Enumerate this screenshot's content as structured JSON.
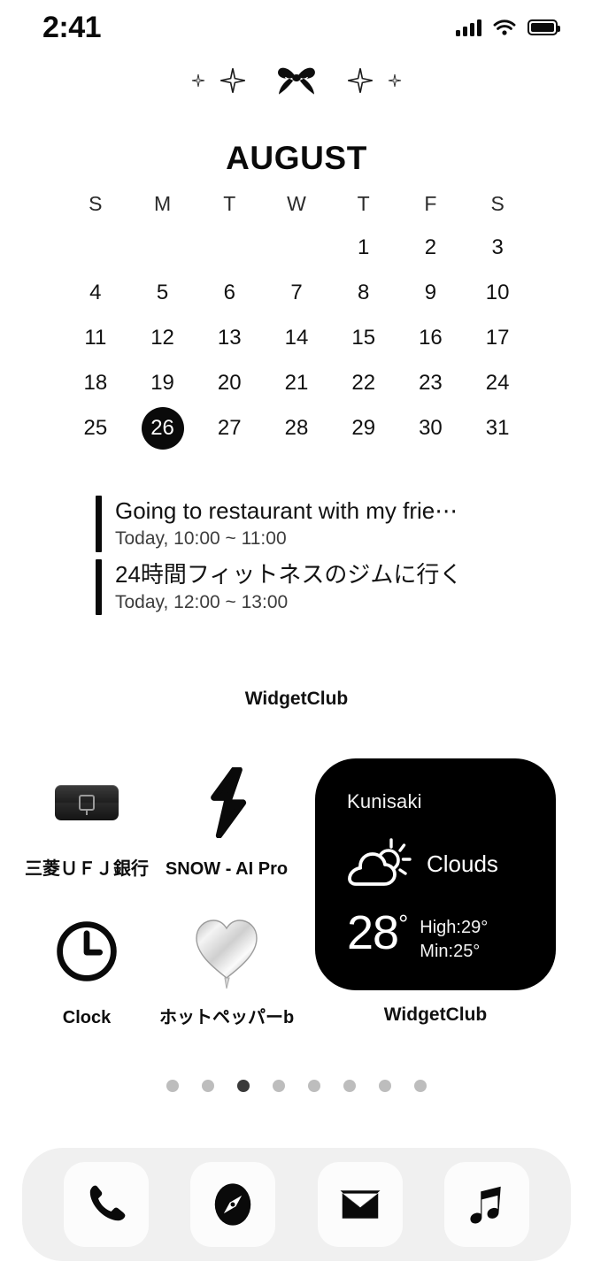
{
  "status_bar": {
    "time": "2:41",
    "signal_icon": "cellular-signal-icon",
    "wifi_icon": "wifi-icon",
    "battery_icon": "battery-full-icon"
  },
  "decoration": {
    "items": [
      "sparkle-small-icon",
      "sparkle-medium-icon",
      "bow-ribbon-icon",
      "sparkle-medium-icon",
      "sparkle-small-icon"
    ]
  },
  "calendar_widget": {
    "month": "AUGUST",
    "day_headers": [
      "S",
      "M",
      "T",
      "W",
      "T",
      "F",
      "S"
    ],
    "leading_blanks": 4,
    "days": [
      1,
      2,
      3,
      4,
      5,
      6,
      7,
      8,
      9,
      10,
      11,
      12,
      13,
      14,
      15,
      16,
      17,
      18,
      19,
      20,
      21,
      22,
      23,
      24,
      25,
      26,
      27,
      28,
      29,
      30,
      31
    ],
    "today": 26,
    "events": [
      {
        "title": "Going to restaurant with my frie⋯",
        "time": "Today, 10:00 ~ 11:00"
      },
      {
        "title": "24時間フィットネスのジムに行く",
        "time": "Today, 12:00 ~ 13:00"
      }
    ],
    "caption": "WidgetClub"
  },
  "apps": [
    {
      "label": "三菱ＵＦＪ銀行",
      "icon": "wallet-icon"
    },
    {
      "label": "SNOW - AI Pro",
      "icon": "lightning-bolt-icon"
    },
    {
      "label": "Clock",
      "icon": "clock-icon"
    },
    {
      "label": "ホットペッパーb",
      "icon": "heart-balloon-icon"
    }
  ],
  "weather_widget": {
    "city": "Kunisaki",
    "icon": "sun-behind-cloud-icon",
    "condition": "Clouds",
    "temperature": "28",
    "degree": "°",
    "high": "High:29°",
    "min": "Min:25°",
    "caption": "WidgetClub",
    "background_color": "#000000"
  },
  "page_dots": {
    "count": 8,
    "active_index": 2
  },
  "dock": {
    "apps": [
      {
        "name": "Phone",
        "icon": "phone-icon"
      },
      {
        "name": "Safari",
        "icon": "safari-compass-icon"
      },
      {
        "name": "Mail",
        "icon": "mail-envelope-icon"
      },
      {
        "name": "Music",
        "icon": "music-note-icon"
      }
    ]
  }
}
